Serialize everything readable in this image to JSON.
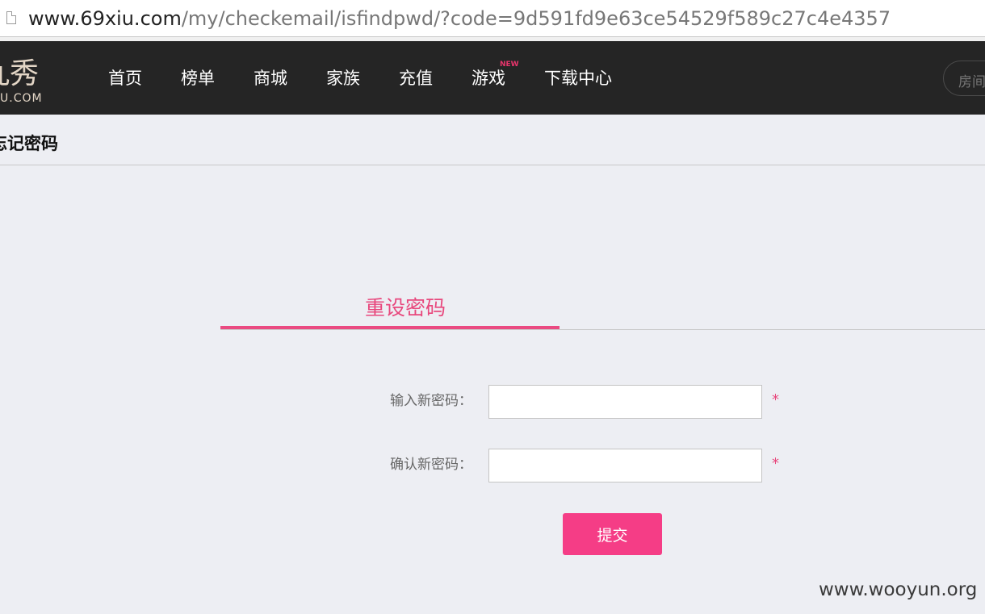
{
  "browser": {
    "url_host": "www.69xiu.com",
    "url_path": "/my/checkemail/isfindpwd/?code=9d591fd9e63ce54529f589c27c4e4357"
  },
  "logo": {
    "main": "九秀",
    "sub": "U.COM"
  },
  "nav": {
    "items": [
      "首页",
      "榜单",
      "商城",
      "家族",
      "充值",
      "游戏",
      "下载中心"
    ],
    "new_badge": "NEW",
    "room_search_placeholder": "房间"
  },
  "subheader": {
    "title": "忘记密码"
  },
  "tab": {
    "title": "重设密码"
  },
  "form": {
    "new_password_label": "输入新密码：",
    "confirm_password_label": "确认新密码：",
    "new_password_value": "",
    "confirm_password_value": "",
    "required_mark": "*",
    "submit_label": "提交"
  },
  "watermark": "www.wooyun.org",
  "colors": {
    "accent": "#ea4a81",
    "nav_bg": "#252525",
    "button": "#f53d86"
  }
}
